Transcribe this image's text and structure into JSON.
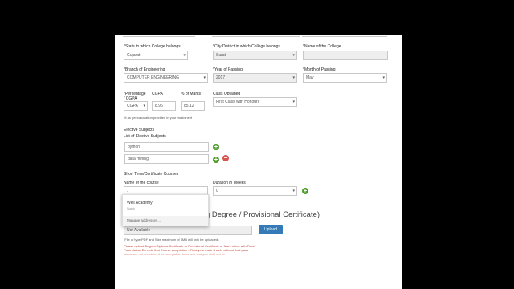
{
  "form": {
    "state_label": "*State to which College belongs",
    "state_value": "Gujarat",
    "city_label": "*City/District in which College belongs",
    "city_value": "Surat",
    "college_label": "*Name of the College",
    "branch_label": "*Branch of Engineering",
    "branch_value": "COMPUTER ENGINEERING",
    "year_label": "*Year of Passing",
    "year_value": "2017",
    "month_label": "*Month of Passing",
    "month_value": "May",
    "percentage_label": "*Percentage / CGPA",
    "cgpa_label": "CGPA",
    "marks_label": "% of Marks",
    "percentage_select": "CGPA",
    "cgpa_value": "8.96",
    "marks_value": "85.12",
    "class_label": "Class Obtained",
    "class_value": "First Class with Honours",
    "calc_note": "% as per calculation provided in your marksheet"
  },
  "electives": {
    "heading": "Elective Subjects",
    "list_label": "List of Elective Subjects",
    "items": [
      "python",
      "data mining"
    ]
  },
  "courses": {
    "heading": "Short Term/Certificate Courses",
    "name_label": "Name of the course",
    "name_value": ".",
    "duration_label": "Duration in Weeks",
    "duration_value": "0"
  },
  "autocomplete": {
    "name": "Well Academy",
    "sub": "Surat",
    "manage": "Manage addresses..."
  },
  "degree": {
    "heading_partial": "g Degree / Provisional Certificate)",
    "file_value": "Not Available",
    "upload_label": "Upload",
    "file_note": "(File of type PDF and Size maximum of 1MB will only be uploaded)",
    "warning_1": "Please upload Degree/Diploma Certificate or Provisional Certificate or Mark sheet with Final",
    "warning_2": "Pass status. Do note that Course completion - Final year mark sheets without final pass",
    "warning_3": "status are not considered as acceptable document and you shall not be"
  }
}
